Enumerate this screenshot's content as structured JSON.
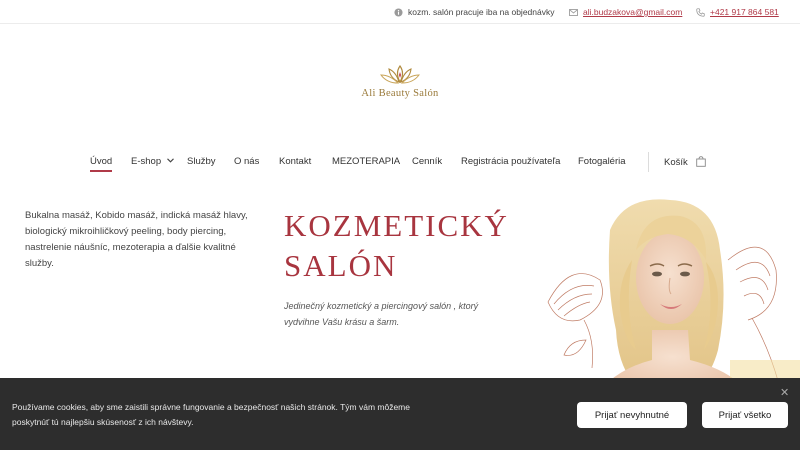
{
  "topbar": {
    "notice_icon": "info-icon",
    "notice": "kozm. salón pracuje iba na objednávky",
    "email_icon": "mail-icon",
    "email": "ali.budzakova@gmail.com",
    "phone_icon": "phone-icon",
    "phone": "+421 917 864 581"
  },
  "logo": {
    "text": "Ali Beauty Salón",
    "icon": "lotus-icon",
    "color": "#9a7a3a"
  },
  "nav": {
    "items": [
      "Úvod",
      "E-shop",
      "Služby",
      "O nás",
      "Kontakt",
      "MEZOTERAPIA",
      "Cenník",
      "Registrácia používateľa",
      "Fotogaléria"
    ],
    "active": "Úvod",
    "cart_label": "Košík",
    "cart_icon": "shopping-bag-icon"
  },
  "hero": {
    "description": "Bukalna masáž, Kobido masáž, indická masáž hlavy, biologický mikroihličkový peeling, body piercing, nastrelenie náušníc, mezoterapia a ďalšie kvalitné služby.",
    "title_line1": "KOZMETICKÝ",
    "title_line2": "SALÓN",
    "subtitle": "Jedinečný kozmetický a piercingový salón , ktorý vydvihne Vašu krásu a šarm.",
    "accent_color": "#a8353f"
  },
  "cookie": {
    "text": "Používame cookies, aby sme zaistili správne fungovanie a bezpečnosť našich stránok. Tým vám môžeme poskytnúť tú najlepšiu skúsenosť z ich návštevy.",
    "btn_necessary": "Prijať nevyhnutné",
    "btn_all": "Prijať všetko",
    "close_icon": "close-icon",
    "close_glyph": "✕"
  }
}
